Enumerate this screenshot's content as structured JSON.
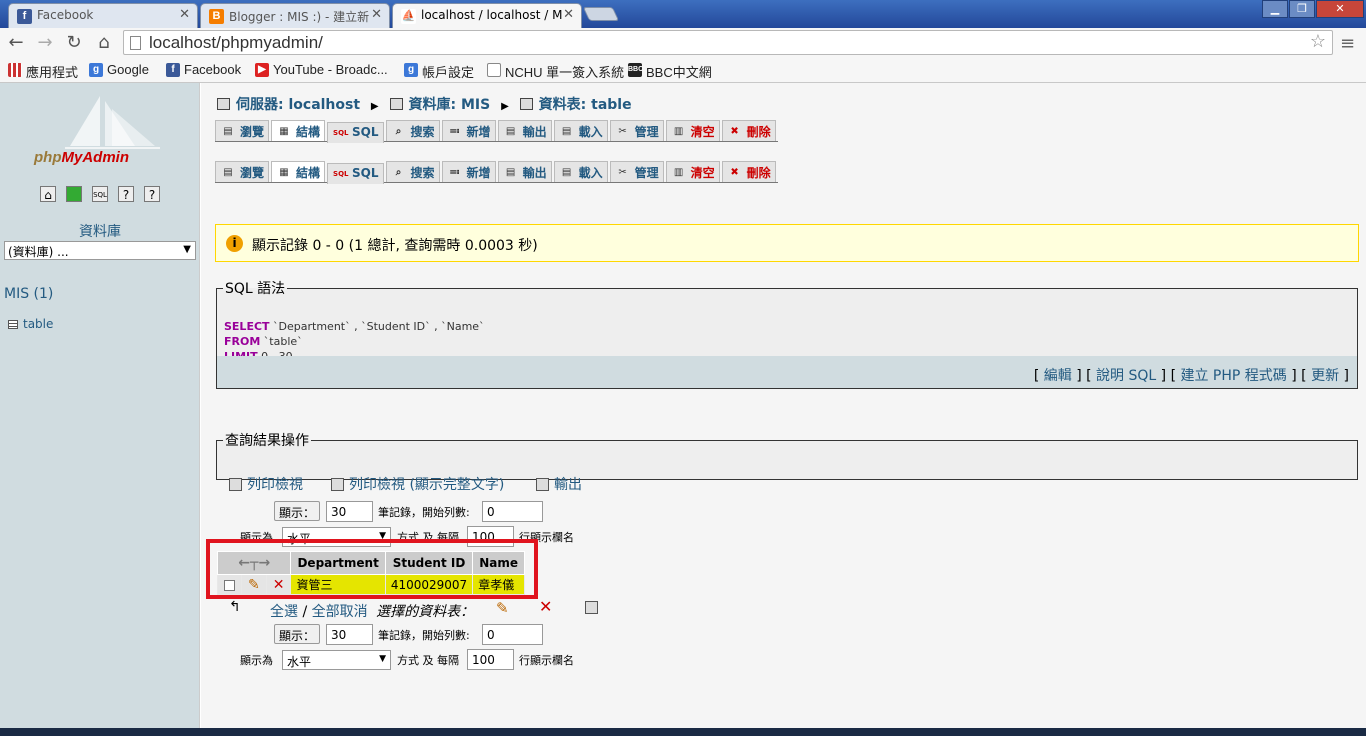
{
  "browser": {
    "tabs": [
      {
        "title": "Facebook",
        "favicon": "facebook-icon",
        "color": "#3b5998",
        "glyph": "f"
      },
      {
        "title": "Blogger : MIS :) - 建立新",
        "favicon": "blogger-icon",
        "color": "#f57d00",
        "glyph": "B"
      },
      {
        "title": "localhost / localhost / M",
        "favicon": "pma-icon",
        "color": "#9a7a3a",
        "glyph": "⛵",
        "active": true
      }
    ],
    "url": "localhost/phpmyadmin/",
    "bookmarks": [
      {
        "label": "應用程式",
        "icon": "apps-grid-icon"
      },
      {
        "label": "Google",
        "icon": "google-icon"
      },
      {
        "label": "Facebook",
        "icon": "facebook-icon"
      },
      {
        "label": "YouTube - Broadc...",
        "icon": "youtube-icon"
      },
      {
        "label": "帳戶設定",
        "icon": "google-icon"
      },
      {
        "label": "NCHU 單一簽入系統",
        "icon": "page-icon"
      },
      {
        "label": "BBC中文網",
        "icon": "bbc-icon"
      }
    ]
  },
  "left": {
    "logo_a": "php",
    "logo_b": "MyAdmin",
    "db_label": "資料庫",
    "db_select": "(資料庫) ...",
    "db_name": "MIS (1)",
    "table_name": "table"
  },
  "breadcrumb": {
    "server": "伺服器: localhost",
    "database": "資料庫: MIS",
    "table": "資料表: table"
  },
  "tabs": [
    "瀏覽",
    "結構",
    "SQL",
    "搜索",
    "新增",
    "輸出",
    "載入",
    "管理",
    "清空",
    "刪除"
  ],
  "notice": "顯示記錄 0 - 0 (1 總計, 查詢需時 0.0003 秒)",
  "sql": {
    "legend": "SQL 語法",
    "kw_select": "SELECT",
    "select_cols": " `Department` , `Student ID` , `Name`",
    "kw_from": "FROM",
    "from_table": " `table`",
    "kw_limit": "LIMIT",
    "limit_vals": " 0 , 30",
    "links": [
      "編輯",
      "說明 SQL",
      "建立 PHP 程式碼",
      "更新"
    ]
  },
  "ops": {
    "legend": "查詢結果操作",
    "print": "列印檢視",
    "print_full": "列印檢視 (顯示完整文字)",
    "export": "輸出"
  },
  "nav": {
    "show_btn": "顯示：",
    "rows": "30",
    "rows_label": "筆記錄，開始列數:",
    "start": "0",
    "mode_label": "顯示為",
    "mode": "水平",
    "mode_suffix": "方式 及 每隔",
    "repeat": "100",
    "repeat_label": "行顯示欄名"
  },
  "results": {
    "columns": [
      "Department",
      "Student ID",
      "Name"
    ],
    "rows": [
      [
        "資管三",
        "4100029007",
        "章孝儀"
      ]
    ]
  },
  "selection": {
    "all": "全選",
    "none": "全部取消",
    "label": "選擇的資料表："
  }
}
